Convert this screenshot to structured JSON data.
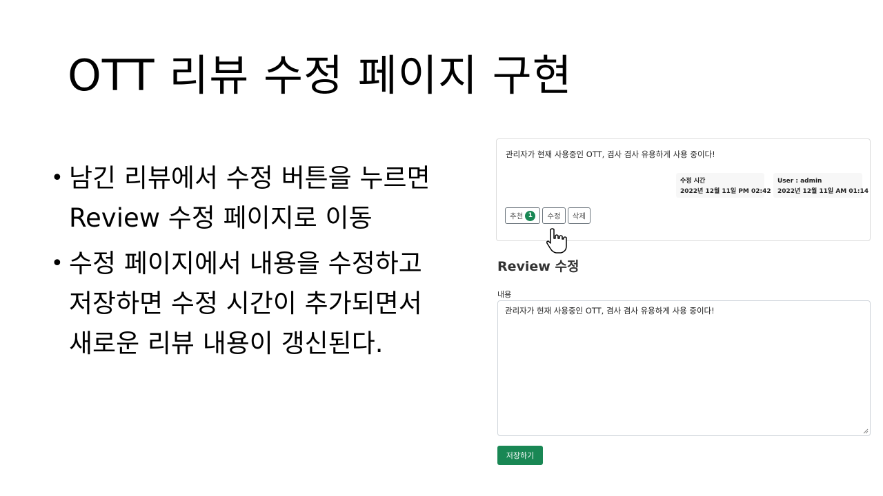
{
  "slide": {
    "title": "OTT 리뷰 수정 페이지 구현",
    "bullets": [
      {
        "dot": "•",
        "lines": [
          "남긴 리뷰에서 수정 버튼을 누르면",
          "Review 수정 페이지로 이동"
        ]
      },
      {
        "dot": "•",
        "lines": [
          "수정 페이지에서 내용을 수정하고",
          "저장하면 수정 시간이 추가되면서",
          "새로운 리뷰 내용이 갱신된다."
        ]
      }
    ]
  },
  "review_card": {
    "content": "관리자가 현재 사용중인 OTT, 겸사 겸사 유용하게 사용 중이다!",
    "modified": {
      "label": "수정 시간",
      "value": "2022년 12월 11일 PM 02:42"
    },
    "author": {
      "label": "User : admin",
      "value": "2022년 12월 11일 AM 01:14"
    },
    "buttons": {
      "recommend": "추천",
      "recommend_count": "1",
      "edit": "수정",
      "delete": "삭제"
    }
  },
  "edit_form": {
    "heading": "Review 수정",
    "content_label": "내용",
    "content_value": "관리자가 현재 사용중인 OTT, 겸사 겸사 유용하게 사용 중이다!",
    "save_label": "저장하기"
  },
  "colors": {
    "primary_green": "#198754"
  },
  "icons": {
    "cursor": "hand-pointer-icon",
    "resize": "resize-grip-icon"
  }
}
